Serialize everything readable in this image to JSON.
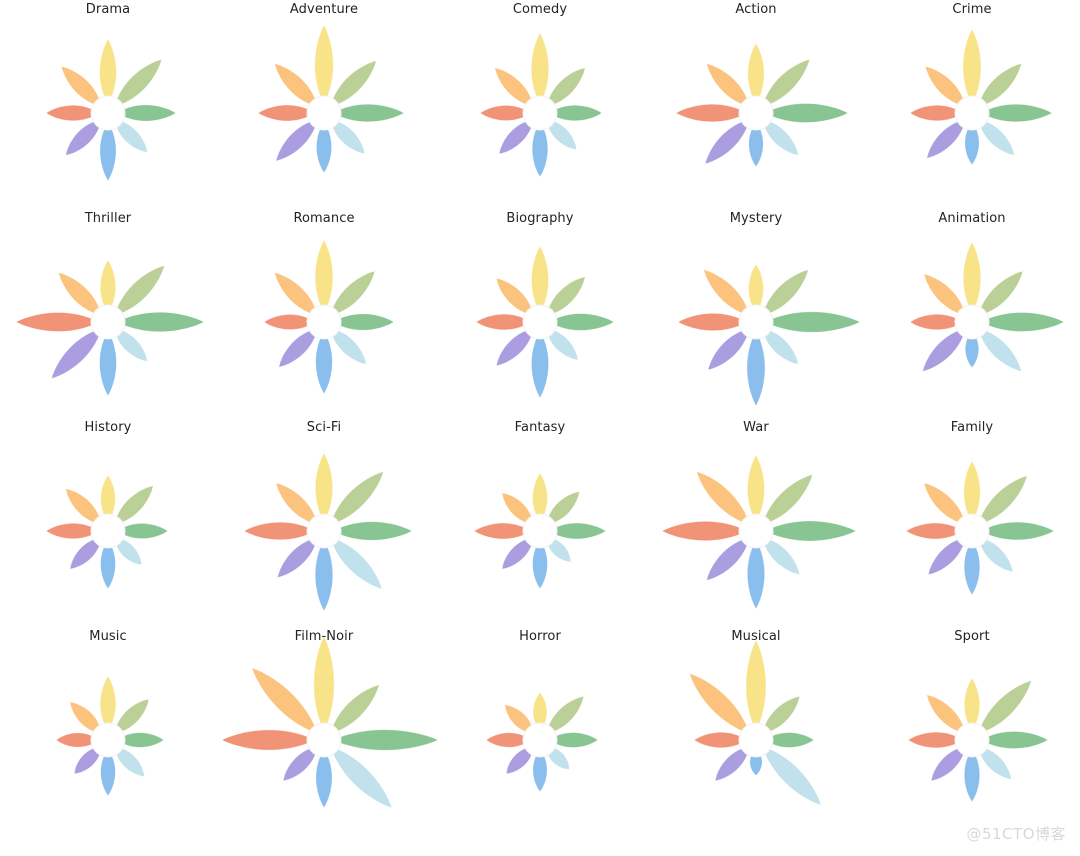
{
  "figure": {
    "background": "#ffffff",
    "grid_rows": 4,
    "grid_cols": 5,
    "label_color": "#232323"
  },
  "watermark": {
    "text": "@51CTO博客",
    "color": "#d8d8d8"
  },
  "chart_data": {
    "type": "radar",
    "title": "",
    "subtitle": "",
    "xlabel": "",
    "ylabel": "",
    "grid": false,
    "legend_position": "none",
    "glyph": "flower-petal-star",
    "petal_count": 8,
    "center_radius": 17,
    "max_petal_length": 100,
    "value_range": [
      0,
      1
    ],
    "notes": "Small multiples: one 8-petal flower glyph per movie genre. Each petal encodes one attribute; petal length is proportional to that attribute's value for the genre.",
    "petal_angles_deg": [
      270,
      315,
      0,
      45,
      90,
      135,
      180,
      225
    ],
    "petal_colors": [
      "#f9e17f",
      "#b5cc8e",
      "#7ec08a",
      "#bcdeea",
      "#7fb9ec",
      "#a396de",
      "#f08a6b",
      "#fbbe72"
    ],
    "petal_labels": [
      "attr-1-yellow",
      "attr-2-olive",
      "attr-3-green",
      "attr-4-pale-cyan",
      "attr-5-blue",
      "attr-6-purple",
      "attr-7-salmon",
      "attr-8-orange"
    ],
    "categories": [
      "Drama",
      "Adventure",
      "Comedy",
      "Action",
      "Crime",
      "Thriller",
      "Romance",
      "Biography",
      "Mystery",
      "Animation",
      "History",
      "Sci-Fi",
      "Fantasy",
      "War",
      "Family",
      "Music",
      "Film-Noir",
      "Horror",
      "Musical",
      "Sport"
    ],
    "series": [
      {
        "name": "Drama",
        "values": [
          0.56,
          0.58,
          0.5,
          0.38,
          0.5,
          0.42,
          0.44,
          0.48
        ]
      },
      {
        "name": "Adventure",
        "values": [
          0.7,
          0.56,
          0.62,
          0.4,
          0.42,
          0.5,
          0.48,
          0.52
        ]
      },
      {
        "name": "Comedy",
        "values": [
          0.62,
          0.46,
          0.44,
          0.34,
          0.46,
          0.4,
          0.42,
          0.46
        ]
      },
      {
        "name": "Action",
        "values": [
          0.52,
          0.58,
          0.74,
          0.42,
          0.36,
          0.54,
          0.62,
          0.52
        ]
      },
      {
        "name": "Crime",
        "values": [
          0.66,
          0.52,
          0.62,
          0.42,
          0.34,
          0.46,
          0.44,
          0.48
        ]
      },
      {
        "name": "Thriller",
        "values": [
          0.44,
          0.62,
          0.78,
          0.38,
          0.56,
          0.62,
          0.74,
          0.52
        ]
      },
      {
        "name": "Romance",
        "values": [
          0.64,
          0.54,
          0.52,
          0.42,
          0.54,
          0.46,
          0.42,
          0.52
        ]
      },
      {
        "name": "Biography",
        "values": [
          0.58,
          0.46,
          0.56,
          0.36,
          0.58,
          0.44,
          0.46,
          0.44
        ]
      },
      {
        "name": "Mystery",
        "values": [
          0.4,
          0.56,
          0.86,
          0.42,
          0.66,
          0.5,
          0.6,
          0.56
        ]
      },
      {
        "name": "Animation",
        "values": [
          0.62,
          0.54,
          0.74,
          0.52,
          0.28,
          0.52,
          0.44,
          0.5
        ]
      },
      {
        "name": "History",
        "values": [
          0.38,
          0.46,
          0.42,
          0.3,
          0.4,
          0.36,
          0.44,
          0.42
        ]
      },
      {
        "name": "Sci-Fi",
        "values": [
          0.6,
          0.66,
          0.7,
          0.64,
          0.62,
          0.48,
          0.62,
          0.5
        ]
      },
      {
        "name": "Fantasy",
        "values": [
          0.4,
          0.38,
          0.48,
          0.26,
          0.4,
          0.36,
          0.48,
          0.36
        ]
      },
      {
        "name": "War",
        "values": [
          0.58,
          0.62,
          0.82,
          0.44,
          0.6,
          0.52,
          0.76,
          0.66
        ]
      },
      {
        "name": "Family",
        "values": [
          0.52,
          0.6,
          0.64,
          0.4,
          0.46,
          0.44,
          0.48,
          0.5
        ]
      },
      {
        "name": "Music",
        "values": [
          0.46,
          0.4,
          0.38,
          0.34,
          0.38,
          0.3,
          0.34,
          0.36
        ]
      },
      {
        "name": "Film-Noir",
        "values": [
          0.86,
          0.6,
          0.96,
          0.78,
          0.5,
          0.4,
          0.84,
          0.84
        ]
      },
      {
        "name": "Horror",
        "values": [
          0.3,
          0.44,
          0.4,
          0.24,
          0.34,
          0.3,
          0.36,
          0.32
        ]
      },
      {
        "name": "Musical",
        "values": [
          0.82,
          0.44,
          0.4,
          0.74,
          0.18,
          0.4,
          0.44,
          0.76
        ]
      },
      {
        "name": "Sport",
        "values": [
          0.44,
          0.66,
          0.58,
          0.38,
          0.44,
          0.4,
          0.46,
          0.46
        ]
      }
    ]
  }
}
